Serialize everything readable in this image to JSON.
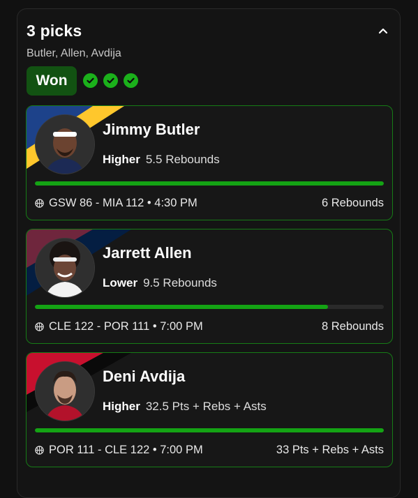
{
  "header": {
    "title": "3 picks",
    "players_summary": "Butler, Allen, Avdija",
    "status": "Won",
    "check_count": 3
  },
  "colors": {
    "accent_green": "#14a314",
    "won_badge_bg": "#125212",
    "card_border": "#167c16"
  },
  "picks": [
    {
      "player": "Jimmy Butler",
      "direction": "Higher",
      "line": "5.5 Rebounds",
      "game": "GSW 86 - MIA 112 • 4:30 PM",
      "result": "6 Rebounds",
      "progress": 1.0,
      "team_colors": [
        "#1d428a",
        "#ffc72c"
      ]
    },
    {
      "player": "Jarrett Allen",
      "direction": "Lower",
      "line": "9.5 Rebounds",
      "game": "CLE 122 - POR 111 • 7:00 PM",
      "result": "8 Rebounds",
      "progress": 0.84,
      "team_colors": [
        "#6f263d",
        "#041e42"
      ]
    },
    {
      "player": "Deni Avdija",
      "direction": "Higher",
      "line": "32.5 Pts + Rebs + Asts",
      "game": "POR 111 - CLE 122 • 7:00 PM",
      "result": "33 Pts + Rebs + Asts",
      "progress": 1.0,
      "team_colors": [
        "#c8102e",
        "#000000"
      ]
    }
  ]
}
